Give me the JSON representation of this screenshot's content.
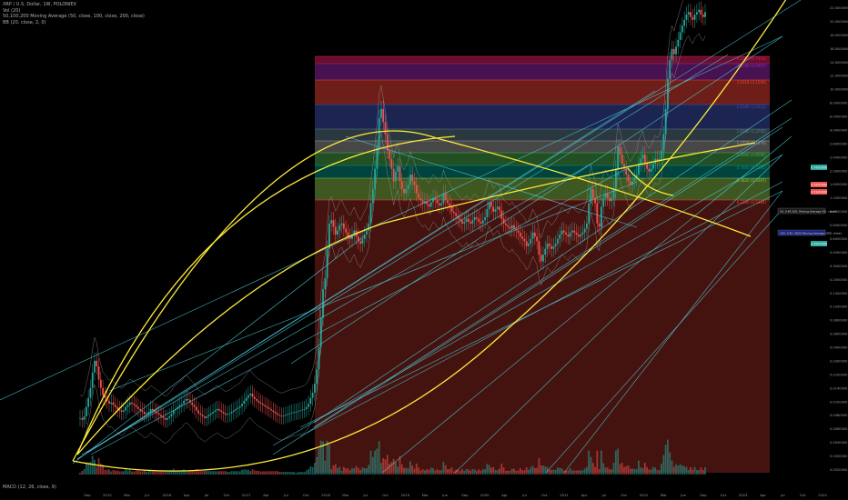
{
  "header": {
    "symbol_line": "XRP / U.S. Dollar, 1W, POLONIEX",
    "vol_line": "Vol (20)",
    "ma_line": "50,100,200 Moving Average (50, close, 100, close, 200, close)",
    "bb_line": "BB (20, close, 2, 0)",
    "macd_line": "MACD (12, 26, close, 9)"
  },
  "colors": {
    "background": "#000000",
    "up_candle": "#26a69a",
    "down_candle": "#ef5350",
    "yellow_arc": "#ffeb3b",
    "trendline": "#4dd0e1",
    "bollinger": "#9e9e9e",
    "ma": "#3f51b5"
  },
  "chart_data": {
    "type": "candlestick",
    "scale": "log",
    "grid": false,
    "x_tick_labels": [
      "Sep",
      "2015",
      "Mar",
      "Jul",
      "2016",
      "Apr",
      "Jul",
      "Oct",
      "2017",
      "Apr",
      "Jul",
      "Oct",
      "2018",
      "Mar",
      "Jul",
      "Oct",
      "2019",
      "Mar",
      "Jun",
      "Sep",
      "2020",
      "Apr",
      "Jul",
      "Oct",
      "2021",
      "Apr",
      "Jul",
      "Oct",
      "2022",
      "Mar",
      "Jun",
      "Sep",
      "Oct",
      "2023",
      "Apr",
      "Jul",
      "Oct",
      "2024"
    ],
    "y_tick_labels": [
      "22.0000000",
      "20.0000000",
      "18.0000000",
      "16.0000000",
      "14.0000000",
      "12.0000000",
      "10.0000000",
      "8.0000000",
      "6.0000000",
      "4.0000000",
      "2.8000000",
      "2.4000000",
      "2.0000000",
      "1.6000000",
      "1.2000000",
      "1.0000000",
      "0.8000000",
      "0.6000000",
      "0.4000000",
      "0.3000000",
      "0.2000000",
      "0.1400000",
      "0.1000000",
      "0.0800000",
      "0.0600000",
      "0.0400000",
      "0.0300000",
      "0.0200000",
      "0.0140000",
      "0.0100000",
      "0.0080000",
      "0.0060000",
      "0.0040000",
      "0.0030000",
      "0.0020000"
    ],
    "fib_levels": [
      {
        "label": "4.2360 (6.7453)",
        "color": "#e91e63"
      },
      {
        "label": "3.6180 (4.9961)",
        "color": "#9c27b0"
      },
      {
        "label": "3.1618 (3.1546)",
        "color": "#f44336"
      },
      {
        "label": "2.6180 (2.2021)",
        "color": "#3f51b5"
      },
      {
        "label": "1.6180 (1.3745)",
        "color": "#607d8b"
      },
      {
        "label": "1.2720 (1.1476)",
        "color": "#9e9e9e"
      },
      {
        "label": "1.0000 (0.8566)",
        "color": "#4caf50"
      },
      {
        "label": "0.7860 (0.7386)",
        "color": "#009688"
      },
      {
        "label": "0.3820 (0.6397)",
        "color": "#8bc34a"
      },
      {
        "label": "0.2360 (0.5469)",
        "color": "#f44336"
      }
    ],
    "price_labels": [
      {
        "text": "0.7450000",
        "color": "#26a69a"
      },
      {
        "text": "0.5450000",
        "color": "#ef5350"
      },
      {
        "text": "0.5100000",
        "color": "#ef5350"
      },
      {
        "text": "0.3500000",
        "color": "#26a69a"
      }
    ],
    "note_labels": [
      "50: 0.46 200: Moving Average (50, close)",
      "100: 0.40 .4000 Moving Average (200, close)"
    ],
    "weekly_closes": [
      0.006,
      0.0058,
      0.0062,
      0.0075,
      0.009,
      0.011,
      0.015,
      0.019,
      0.017,
      0.013,
      0.011,
      0.0095,
      0.009,
      0.0085,
      0.008,
      0.0082,
      0.0078,
      0.0075,
      0.0072,
      0.007,
      0.0068,
      0.007,
      0.0075,
      0.0078,
      0.0082,
      0.008,
      0.0078,
      0.0075,
      0.0072,
      0.007,
      0.0068,
      0.0065,
      0.0066,
      0.0068,
      0.0072,
      0.007,
      0.0068,
      0.0066,
      0.0064,
      0.0062,
      0.006,
      0.0058,
      0.006,
      0.0062,
      0.0065,
      0.007,
      0.0072,
      0.0075,
      0.0078,
      0.008,
      0.0085,
      0.0088,
      0.0086,
      0.0082,
      0.0078,
      0.0075,
      0.007,
      0.0066,
      0.0064,
      0.0062,
      0.006,
      0.0062,
      0.0064,
      0.0066,
      0.0068,
      0.007,
      0.0072,
      0.007,
      0.0068,
      0.0066,
      0.0064,
      0.0065,
      0.0066,
      0.0068,
      0.007,
      0.0072,
      0.0074,
      0.0076,
      0.008,
      0.0085,
      0.009,
      0.0095,
      0.0098,
      0.0092,
      0.0088,
      0.0085,
      0.0082,
      0.008,
      0.0078,
      0.0076,
      0.0074,
      0.0072,
      0.007,
      0.0068,
      0.0066,
      0.0064,
      0.0063,
      0.0062,
      0.0063,
      0.0064,
      0.0065,
      0.0066,
      0.0067,
      0.0068,
      0.0068,
      0.0069,
      0.007,
      0.0071,
      0.0072,
      0.0075,
      0.008,
      0.009,
      0.01,
      0.012,
      0.016,
      0.025,
      0.045,
      0.08,
      0.1,
      0.18,
      0.3,
      0.32,
      0.28,
      0.24,
      0.26,
      0.29,
      0.3,
      0.27,
      0.25,
      0.23,
      0.22,
      0.24,
      0.26,
      0.23,
      0.21,
      0.2,
      0.22,
      0.24,
      0.26,
      0.3,
      0.45,
      0.6,
      0.9,
      1.4,
      2.5,
      3.0,
      2.3,
      1.8,
      1.3,
      1.1,
      0.9,
      0.7,
      0.85,
      0.95,
      0.7,
      0.6,
      0.55,
      0.6,
      0.65,
      0.8,
      0.7,
      0.65,
      0.55,
      0.5,
      0.48,
      0.45,
      0.47,
      0.44,
      0.42,
      0.46,
      0.5,
      0.48,
      0.45,
      0.43,
      0.45,
      0.55,
      0.48,
      0.45,
      0.42,
      0.38,
      0.37,
      0.35,
      0.33,
      0.32,
      0.3,
      0.31,
      0.33,
      0.31,
      0.3,
      0.32,
      0.34,
      0.33,
      0.31,
      0.3,
      0.32,
      0.34,
      0.4,
      0.46,
      0.42,
      0.38,
      0.4,
      0.42,
      0.39,
      0.33,
      0.3,
      0.29,
      0.28,
      0.27,
      0.29,
      0.27,
      0.26,
      0.25,
      0.23,
      0.22,
      0.21,
      0.19,
      0.2,
      0.22,
      0.25,
      0.23,
      0.21,
      0.16,
      0.14,
      0.16,
      0.18,
      0.2,
      0.19,
      0.18,
      0.19,
      0.2,
      0.22,
      0.24,
      0.26,
      0.25,
      0.24,
      0.23,
      0.25,
      0.26,
      0.25,
      0.24,
      0.23,
      0.24,
      0.25,
      0.27,
      0.3,
      0.45,
      0.6,
      0.5,
      0.45,
      0.3,
      0.28,
      0.42,
      0.5,
      0.55,
      0.5,
      0.47,
      0.5,
      0.6,
      0.9,
      1.4,
      1.2,
      1.0,
      0.9,
      0.8,
      0.7,
      0.65,
      0.7,
      0.75,
      0.8,
      1.0,
      1.1,
      1.2,
      1.0,
      0.9,
      0.85,
      0.9,
      1.0,
      1.1,
      1.05,
      1.1,
      1.3,
      1.8,
      3.0,
      5.5,
      8.0,
      10.0,
      9.0,
      10.5,
      12.0,
      14.0,
      16.0,
      18.0,
      20.0,
      21.0,
      19.0,
      18.0,
      20.0,
      21.0,
      22.0,
      20.0,
      19.0,
      21.0
    ]
  }
}
